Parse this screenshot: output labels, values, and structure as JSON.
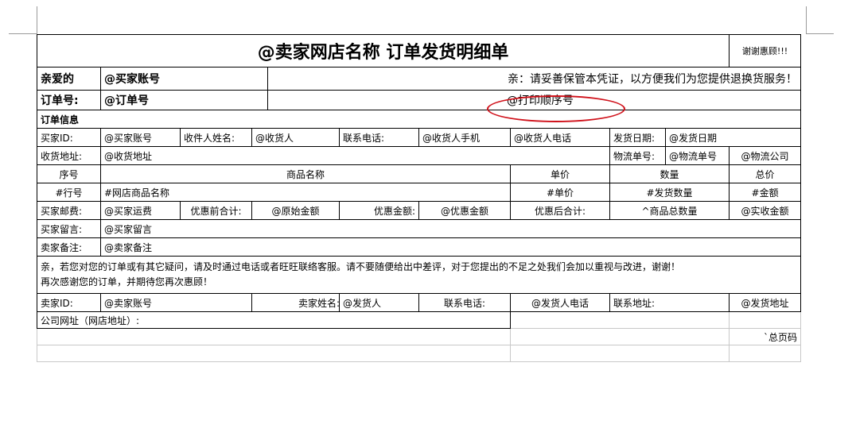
{
  "header": {
    "title": "@卖家网店名称 订单发货明细单",
    "thanks": "谢谢惠顾!!!"
  },
  "greeting": {
    "dear_label": "亲爱的",
    "buyer_account": "@买家账号",
    "message": "亲：请妥善保管本凭证，以方便我们为您提供退换货服务！"
  },
  "order": {
    "number_label": "订单号:",
    "number_value": "@订单号",
    "print_seq": "@打印顺序号"
  },
  "order_info": {
    "section_label": "订单信息",
    "buyer_id_label": "买家ID:",
    "buyer_id_value": "@买家账号",
    "receiver_name_label": "收件人姓名:",
    "receiver_name_value": "@收货人",
    "phone_label": "联系电话:",
    "mobile_value": "@收货人手机",
    "phone_value": "@收货人电话",
    "ship_date_label": "发货日期:",
    "ship_date_value": "@发货日期",
    "address_label": "收货地址:",
    "address_value": "@收货地址",
    "tracking_label": "物流单号:",
    "tracking_value": "@物流单号",
    "carrier_value": "@物流公司"
  },
  "items": {
    "headers": [
      "序号",
      "商品名称",
      "单价",
      "数量",
      "总价"
    ],
    "row": [
      "#行号",
      "#网店商品名称",
      "#单价",
      "#发货数量",
      "#金额"
    ]
  },
  "totals": {
    "shipping_label": "买家邮费:",
    "shipping_value": "@买家运费",
    "pre_discount_label": "优惠前合计:",
    "pre_discount_value": "@原始金额",
    "discount_label": "优惠金额:",
    "discount_value": "@优惠金额",
    "post_discount_label": "优惠后合计:",
    "total_qty_value": "^商品总数量",
    "received_value": "@实收金额"
  },
  "buyer_message": {
    "label": "买家留言:",
    "value": "@买家留言"
  },
  "seller_note": {
    "label": "卖家备注:",
    "value": "@卖家备注"
  },
  "notice": {
    "line1": "亲，若您对您的订单或有其它疑问，请及时通过电话或者旺旺联络客服。请不要随便给出中差评，对于您提出的不足之处我们会加以重视与改进，谢谢！",
    "line2": "再次感谢您的订单，并期待您再次惠顾！"
  },
  "seller": {
    "id_label": "卖家ID:",
    "id_value": "@卖家账号",
    "name_label": "卖家姓名:",
    "name_value": "@发货人",
    "phone_label": "联系电话:",
    "phone_value": "@发货人电话",
    "address_label": "联系地址:",
    "address_value": "@发货地址"
  },
  "footer": {
    "website_label": "公司网址（网店地址）:",
    "total_pages": "`总页码"
  },
  "colors": {
    "annotation": "#d0121b"
  }
}
